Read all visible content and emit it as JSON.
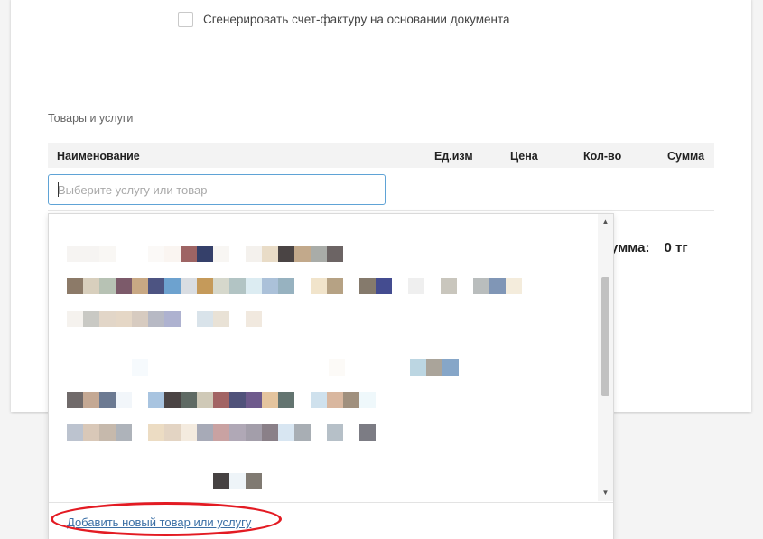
{
  "invoice": {
    "label": "Сгенерировать счет-фактуру на основании документа",
    "checked": false
  },
  "section_title": "Товары и услуги",
  "table": {
    "headers": {
      "name": "Наименование",
      "unit": "Ед.изм",
      "price": "Цена",
      "qty": "Кол-во",
      "sum": "Сумма"
    }
  },
  "search": {
    "placeholder": "Выберите услугу или товар",
    "value": ""
  },
  "total": {
    "label": "умма:",
    "amount": "0 тг"
  },
  "dropdown": {
    "items_note": "blurred",
    "add_link": "Добавить новый товар или услугу",
    "scroll_up": "▲",
    "scroll_down": "▼"
  },
  "colors": {
    "accent": "#3b6fa5",
    "input_focus": "#5fa3d6",
    "highlight": "#e31b23"
  }
}
